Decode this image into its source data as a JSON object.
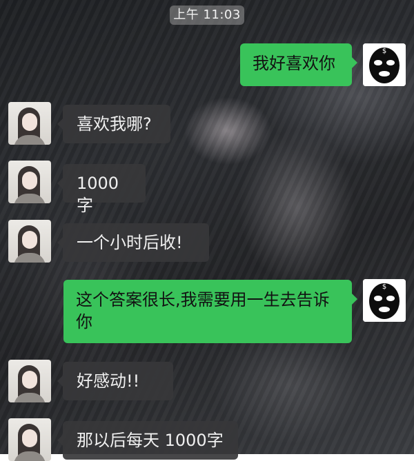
{
  "status": {
    "time": "上午 11:03"
  },
  "chat": {
    "messages": [
      {
        "side": "outgoing",
        "text": "我好喜欢你",
        "avatar": "masked-person-avatar"
      },
      {
        "side": "incoming",
        "text": "喜欢我哪?",
        "avatar": "girl-avatar"
      },
      {
        "side": "incoming",
        "text": "1000字",
        "avatar": "girl-avatar"
      },
      {
        "side": "incoming",
        "text": "一个小时后收!",
        "avatar": "girl-avatar"
      },
      {
        "side": "outgoing",
        "text": "这个答案很长,我需要用一生去告诉你",
        "avatar": "masked-person-avatar"
      },
      {
        "side": "incoming",
        "text": "好感动!!",
        "avatar": "girl-avatar"
      },
      {
        "side": "incoming",
        "text": "那以后每天 1000字",
        "avatar": "girl-avatar"
      }
    ]
  },
  "colors": {
    "outgoing_bubble": "#39c35a",
    "incoming_bubble": "#373739",
    "time_pill": "#969696"
  }
}
